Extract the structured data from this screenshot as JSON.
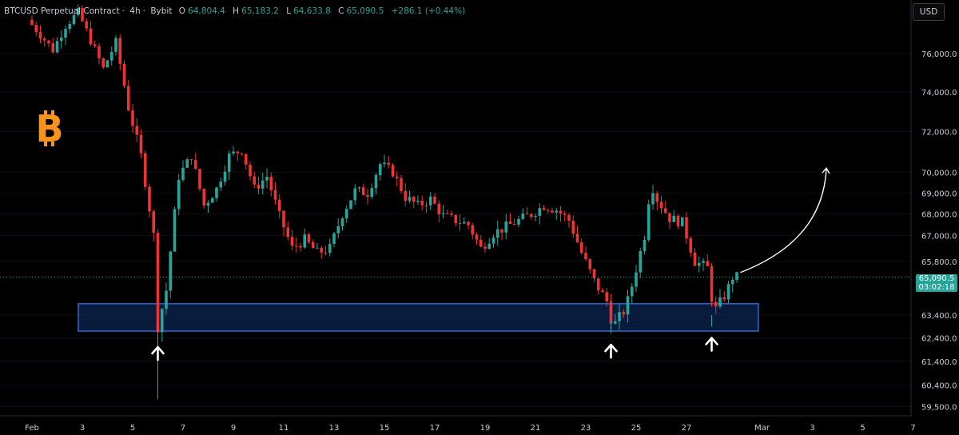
{
  "header": {
    "symbol": "BTCUSD Perpetual Contract",
    "interval": "4h",
    "exchange": "Bybit",
    "open_label": "O",
    "open": "64,804.4",
    "high_label": "H",
    "high": "65,183.2",
    "low_label": "L",
    "low": "64,633.8",
    "close_label": "C",
    "close": "65,090.5",
    "change": "+286.1 (+0.44%)"
  },
  "currency_button": "USD",
  "current_price": {
    "price": "65,090.5",
    "countdown": "03:02:18",
    "value": 65090.5
  },
  "colors": {
    "up": "#26a69a",
    "down": "#ef3333",
    "background": "#000000",
    "zone_fill": "#0d2a5c",
    "zone_border": "#2f6fe0",
    "bitcoin": "#f7931a",
    "arrow": "#ffffff"
  },
  "icons": [
    "bitcoin-icon",
    "up-arrow-icon",
    "curved-arrow-icon"
  ],
  "chart_data": {
    "type": "candlestick",
    "title": "",
    "y_axis": {
      "ticks": [
        59500,
        60400,
        61400,
        62400,
        63400,
        65800,
        67000,
        68000,
        69000,
        70000,
        72000,
        74000,
        76000
      ],
      "tick_labels": [
        "59,500.0",
        "60,400.0",
        "61,400.0",
        "62,400.0",
        "63,400.0",
        "65,800.0",
        "67,000.0",
        "68,000.0",
        "69,000.0",
        "70,000.0",
        "72,000.0",
        "74,000.0",
        "76,000.0"
      ],
      "scale": "log"
    },
    "x_axis": {
      "labels": [
        "Feb",
        "3",
        "5",
        "7",
        "9",
        "11",
        "13",
        "15",
        "17",
        "19",
        "21",
        "23",
        "25",
        "27",
        "Mar",
        "3",
        "5",
        "7"
      ],
      "dates": [
        "2024-02-01",
        "2024-02-03",
        "2024-02-05",
        "2024-02-07",
        "2024-02-09",
        "2024-02-11",
        "2024-02-13",
        "2024-02-15",
        "2024-02-17",
        "2024-02-19",
        "2024-02-21",
        "2024-02-23",
        "2024-02-25",
        "2024-02-27",
        "2024-03-01",
        "2024-03-03",
        "2024-03-05",
        "2024-03-07"
      ]
    },
    "support_zone": {
      "low": 62700,
      "high": 63900,
      "from": "2024-02-01",
      "to": "2024-03-02"
    },
    "touches": [
      {
        "date": "2024-02-06",
        "price": 62700
      },
      {
        "date": "2024-02-24",
        "price": 62800
      },
      {
        "date": "2024-02-28",
        "price": 63100
      }
    ],
    "projection": {
      "from": {
        "date": "2024-03-01",
        "price": 65300
      },
      "to": {
        "date": "2024-03-04",
        "price": 70200
      }
    },
    "path": [
      {
        "date": "2024-02-01",
        "price": 77800
      },
      {
        "date": "2024-02-02",
        "price": 76200
      },
      {
        "date": "2024-02-02T12",
        "price": 77500
      },
      {
        "date": "2024-02-03",
        "price": 78200
      },
      {
        "date": "2024-02-04",
        "price": 75200
      },
      {
        "date": "2024-02-04T12",
        "price": 76600
      },
      {
        "date": "2024-02-05",
        "price": 73200
      },
      {
        "date": "2024-02-05T12",
        "price": 70800
      },
      {
        "date": "2024-02-06",
        "price": 67000
      },
      {
        "date": "2024-02-06T04",
        "price": 62900
      },
      {
        "date": "2024-02-06T12",
        "price": 64500
      },
      {
        "date": "2024-02-07",
        "price": 69800
      },
      {
        "date": "2024-02-07T12",
        "price": 70800
      },
      {
        "date": "2024-02-08",
        "price": 68400
      },
      {
        "date": "2024-02-08T12",
        "price": 69200
      },
      {
        "date": "2024-02-09",
        "price": 70800
      },
      {
        "date": "2024-02-09T12",
        "price": 71100
      },
      {
        "date": "2024-02-10",
        "price": 69200
      },
      {
        "date": "2024-02-10T12",
        "price": 69800
      },
      {
        "date": "2024-02-11",
        "price": 67900
      },
      {
        "date": "2024-02-11T12",
        "price": 66400
      },
      {
        "date": "2024-02-12",
        "price": 66800
      },
      {
        "date": "2024-02-12T12",
        "price": 66200
      },
      {
        "date": "2024-02-13",
        "price": 66400
      },
      {
        "date": "2024-02-13T12",
        "price": 68000
      },
      {
        "date": "2024-02-14",
        "price": 69100
      },
      {
        "date": "2024-02-14T12",
        "price": 69000
      },
      {
        "date": "2024-02-15",
        "price": 70400
      },
      {
        "date": "2024-02-15T12",
        "price": 70000
      },
      {
        "date": "2024-02-16",
        "price": 68800
      },
      {
        "date": "2024-02-16T12",
        "price": 68400
      },
      {
        "date": "2024-02-17",
        "price": 68700
      },
      {
        "date": "2024-02-17T12",
        "price": 67900
      },
      {
        "date": "2024-02-18",
        "price": 67700
      },
      {
        "date": "2024-02-18T12",
        "price": 67500
      },
      {
        "date": "2024-02-19",
        "price": 66400
      },
      {
        "date": "2024-02-19T12",
        "price": 67100
      },
      {
        "date": "2024-02-20",
        "price": 67400
      },
      {
        "date": "2024-02-20T12",
        "price": 67700
      },
      {
        "date": "2024-02-21",
        "price": 68000
      },
      {
        "date": "2024-02-21T12",
        "price": 68400
      },
      {
        "date": "2024-02-22",
        "price": 68200
      },
      {
        "date": "2024-02-22T12",
        "price": 67700
      },
      {
        "date": "2024-02-23",
        "price": 66200
      },
      {
        "date": "2024-02-23T12",
        "price": 64900
      },
      {
        "date": "2024-02-24",
        "price": 64000
      },
      {
        "date": "2024-02-24T06",
        "price": 62900
      },
      {
        "date": "2024-02-24T18",
        "price": 63700
      },
      {
        "date": "2024-02-25",
        "price": 64700
      },
      {
        "date": "2024-02-25T12",
        "price": 67000
      },
      {
        "date": "2024-02-25T18",
        "price": 69500
      },
      {
        "date": "2024-02-26",
        "price": 68700
      },
      {
        "date": "2024-02-26T12",
        "price": 67800
      },
      {
        "date": "2024-02-27",
        "price": 67600
      },
      {
        "date": "2024-02-27T12",
        "price": 65800
      },
      {
        "date": "2024-02-28",
        "price": 65500
      },
      {
        "date": "2024-02-28T06",
        "price": 63500
      },
      {
        "date": "2024-02-28T18",
        "price": 64400
      },
      {
        "date": "2024-02-29",
        "price": 65090.5
      }
    ]
  }
}
